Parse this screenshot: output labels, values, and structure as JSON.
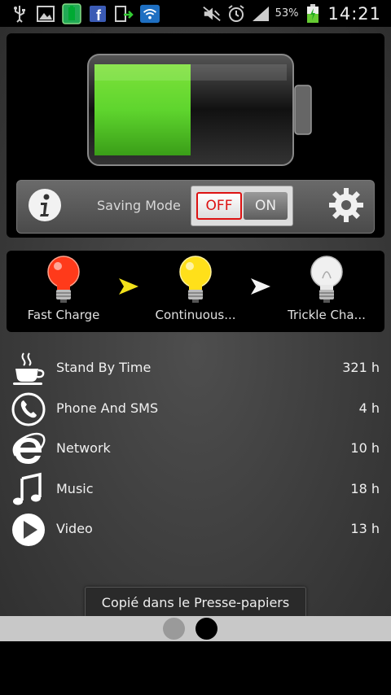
{
  "status_bar": {
    "icons": [
      "usb-icon",
      "gallery-icon",
      "battery-app-icon",
      "facebook-icon",
      "upload-icon",
      "wifi-icon",
      "mute-icon",
      "alarm-icon",
      "signal-icon",
      "battery-charging-icon"
    ],
    "battery_percent": "53%",
    "time": "14:21"
  },
  "battery": {
    "charge_level": 0.5,
    "fill_color": "#5fd52e"
  },
  "controls": {
    "saving_mode_label": "Saving Mode",
    "toggle_off_label": "OFF",
    "toggle_on_label": "ON",
    "toggle_state": "OFF"
  },
  "stages": [
    {
      "label": "Fast Charge",
      "bulb_color": "#ff3a1a",
      "icon": "red-bulb-icon"
    },
    {
      "label": "Continuous...",
      "bulb_color": "#ffe01a",
      "icon": "yellow-bulb-icon"
    },
    {
      "label": "Trickle Cha...",
      "bulb_color": "#f0f0f0",
      "icon": "white-bulb-icon"
    }
  ],
  "stats": [
    {
      "label": "Stand By Time",
      "value": "321 h",
      "icon": "coffee-cup-icon"
    },
    {
      "label": "Phone And SMS",
      "value": "4 h",
      "icon": "phone-icon"
    },
    {
      "label": "Network",
      "value": "10 h",
      "icon": "internet-explorer-icon"
    },
    {
      "label": "Music",
      "value": "18 h",
      "icon": "music-note-icon"
    },
    {
      "label": "Video",
      "value": "13 h",
      "icon": "play-icon"
    }
  ],
  "toast": {
    "text": "Copié dans le Presse-papiers"
  },
  "pager": {
    "page_count": 2,
    "current_page": 2
  }
}
